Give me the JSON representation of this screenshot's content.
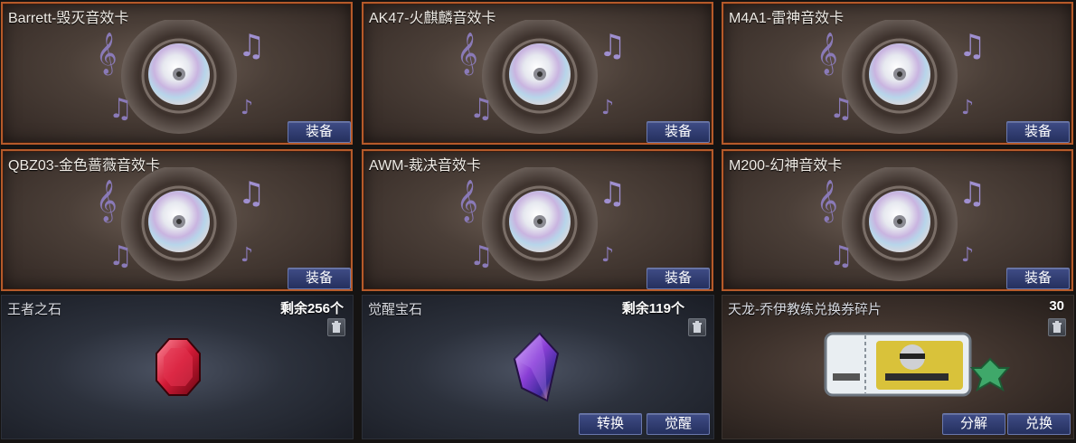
{
  "cards": [
    {
      "title": "Barrett-毁灭音效卡",
      "button": "装备"
    },
    {
      "title": "AK47-火麒麟音效卡",
      "button": "装备"
    },
    {
      "title": "M4A1-雷神音效卡",
      "button": "装备"
    },
    {
      "title": "QBZ03-金色蔷薇音效卡",
      "button": "装备"
    },
    {
      "title": "AWM-裁决音效卡",
      "button": "装备"
    },
    {
      "title": "M200-幻神音效卡",
      "button": "装备"
    }
  ],
  "items": [
    {
      "title": "王者之石",
      "count": "剩余256个",
      "buttons": []
    },
    {
      "title": "觉醒宝石",
      "count": "剩余119个",
      "buttons": [
        "转换",
        "觉醒"
      ]
    },
    {
      "title": "天龙-乔伊教练兑换券碎片",
      "count": "30",
      "buttons": [
        "分解",
        "兑换"
      ]
    }
  ],
  "colors": {
    "card_border": "#b55a2a",
    "button": "#2f3b70",
    "note": "#8a7ab8"
  },
  "icons": [
    "music-note-icon",
    "treble-clef-icon",
    "trash-icon",
    "cd-disc-icon",
    "red-gem-icon",
    "purple-gem-icon",
    "puzzle-piece-icon"
  ]
}
